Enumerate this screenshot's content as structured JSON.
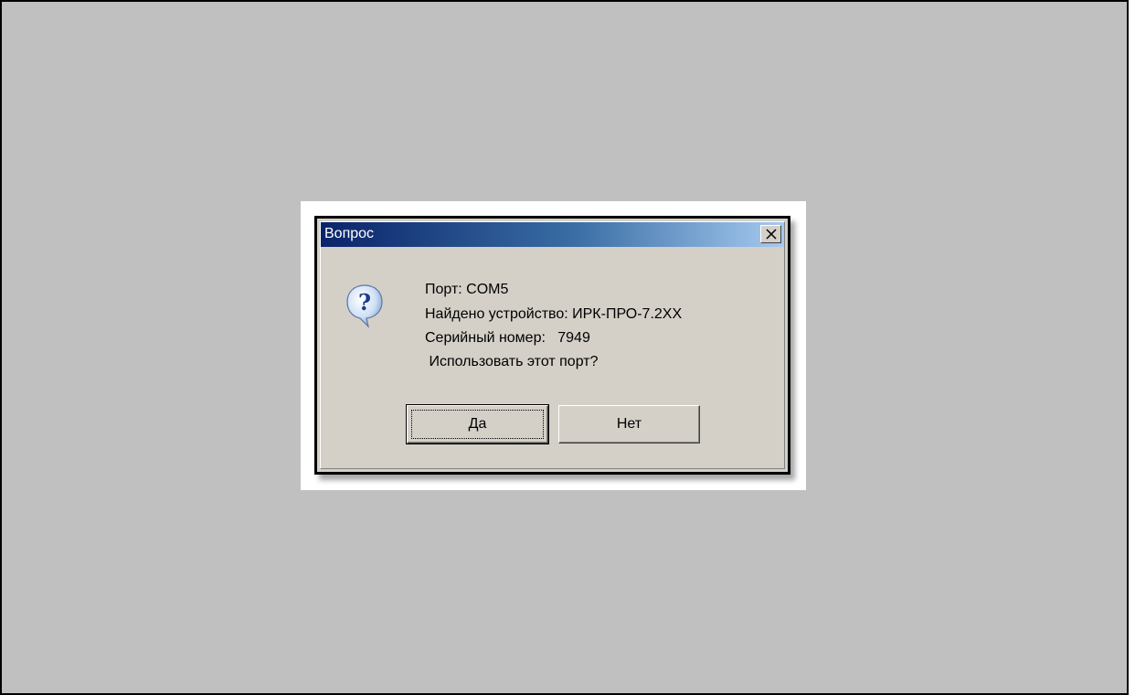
{
  "dialog": {
    "title": "Вопрос",
    "icon": "question-icon",
    "lines": [
      "Порт: COM5",
      "Найдено устройство: ИРК-ПРО-7.2XX",
      "Серийный номер:   7949",
      " Использовать этот порт?"
    ],
    "buttons": {
      "yes": "Да",
      "no": "Нет"
    },
    "close_icon": "close-icon"
  },
  "colors": {
    "desktop": "#c0c0c0",
    "dialog_face": "#d4d0c8",
    "titlebar_start": "#0a246a",
    "titlebar_end": "#a6caf0"
  }
}
